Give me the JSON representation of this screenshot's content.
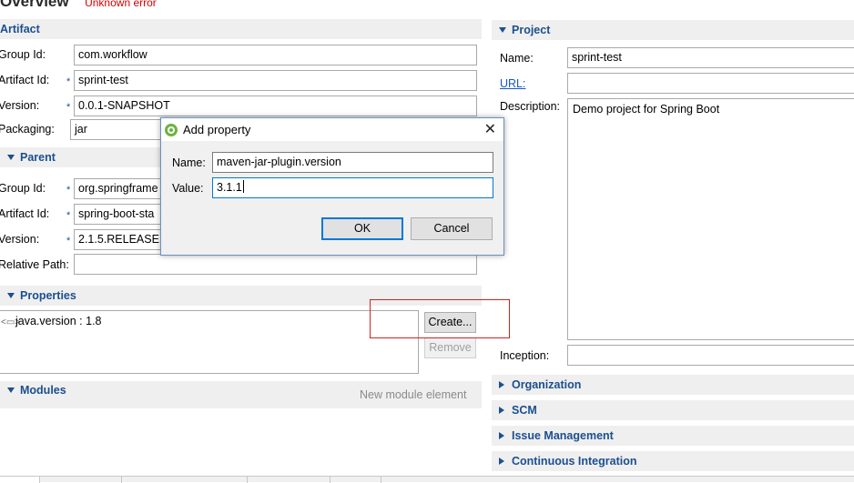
{
  "page": {
    "title": "Overview",
    "error": "Unknown error"
  },
  "artifact": {
    "header": "Artifact",
    "group_id_label": "Group Id:",
    "group_id": "com.workflow",
    "artifact_id_label": "Artifact Id:",
    "artifact_id": "sprint-test",
    "version_label": "Version:",
    "version": "0.0.1-SNAPSHOT",
    "packaging_label": "Packaging:",
    "packaging": "jar"
  },
  "parent": {
    "header": "Parent",
    "group_id_label": "Group Id:",
    "group_id": "org.springframe",
    "artifact_id_label": "Artifact Id:",
    "artifact_id": "spring-boot-sta",
    "version_label": "Version:",
    "version": "2.1.5.RELEASE",
    "relative_path_label": "Relative Path:",
    "relative_path": ""
  },
  "properties": {
    "header": "Properties",
    "items": [
      {
        "label": "java.version : 1.8",
        "icon": "property-icon"
      }
    ],
    "create_label": "Create...",
    "remove_label": "Remove"
  },
  "modules": {
    "header": "Modules",
    "new_label": "New module element"
  },
  "project": {
    "header": "Project",
    "name_label": "Name:",
    "name": "sprint-test",
    "url_label": "URL:",
    "url": "",
    "description_label": "Description:",
    "description": "Demo project for Spring Boot",
    "inception_label": "Inception:",
    "inception": ""
  },
  "collapsed_sections": [
    "Organization",
    "SCM",
    "Issue Management",
    "Continuous Integration"
  ],
  "dialog": {
    "title": "Add property",
    "name_label": "Name:",
    "name_value": "maven-jar-plugin.version",
    "value_label": "Value:",
    "value_value": "3.1.1",
    "ok_label": "OK",
    "cancel_label": "Cancel",
    "close_icon": "close-icon",
    "app_icon": "spring-leaf-icon"
  },
  "colors": {
    "section_header": "#1c4f8f",
    "error": "#d40000",
    "highlight_box": "#d42020",
    "focus": "#0078d7"
  }
}
